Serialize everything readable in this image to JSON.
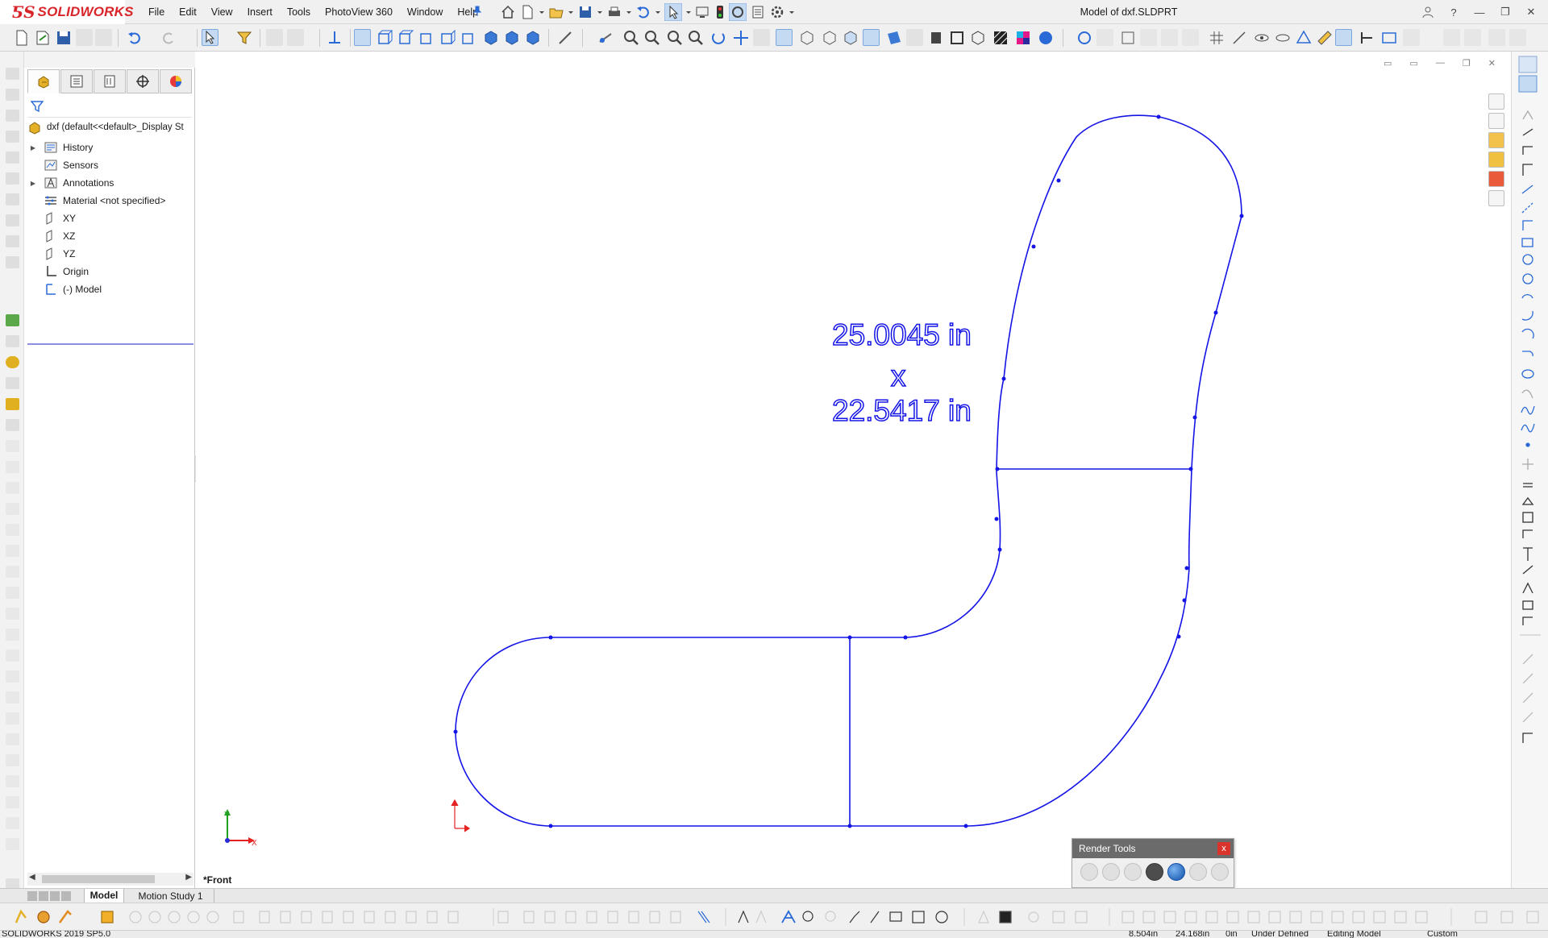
{
  "app": {
    "brand": "SOLIDWORKS",
    "document_title": "Model of dxf.SLDPRT"
  },
  "menu": [
    "File",
    "Edit",
    "View",
    "Insert",
    "Tools",
    "PhotoView 360",
    "Window",
    "Help"
  ],
  "feature_tree": {
    "root_label": "dxf  (default<<default>_Display St",
    "items": [
      {
        "label": "History",
        "expandable": true,
        "icon": "history-icon"
      },
      {
        "label": "Sensors",
        "expandable": false,
        "icon": "sensors-icon"
      },
      {
        "label": "Annotations",
        "expandable": true,
        "icon": "annotations-icon"
      },
      {
        "label": "Material <not specified>",
        "expandable": false,
        "icon": "material-icon"
      },
      {
        "label": "XY",
        "expandable": false,
        "icon": "plane-icon"
      },
      {
        "label": "XZ",
        "expandable": false,
        "icon": "plane-icon"
      },
      {
        "label": "YZ",
        "expandable": false,
        "icon": "plane-icon"
      },
      {
        "label": "Origin",
        "expandable": false,
        "icon": "origin-icon"
      },
      {
        "label": "(-) Model",
        "expandable": false,
        "icon": "sketch-icon"
      }
    ]
  },
  "graphics": {
    "dimension_width": "25.0045 in",
    "dimension_separator": "x",
    "dimension_height": "22.5417 in",
    "view_orientation": "*Front",
    "triad_y": "Y",
    "triad_x": "X",
    "sketch_color": "#1414e6"
  },
  "render_tools": {
    "title": "Render Tools",
    "close": "x"
  },
  "bottom_tabs": {
    "model": "Model",
    "motion": "Motion Study 1"
  },
  "status": {
    "version": "SOLIDWORKS 2019 SP5.0",
    "x": "8.504in",
    "y": "24.168in",
    "z": "0in",
    "state": "Under Defined",
    "mode": "Editing Model",
    "units": "Custom"
  },
  "colors": {
    "brand_red": "#d8252a",
    "accent_blue": "#2a6ad6",
    "sketch_blue": "#1414e6"
  }
}
